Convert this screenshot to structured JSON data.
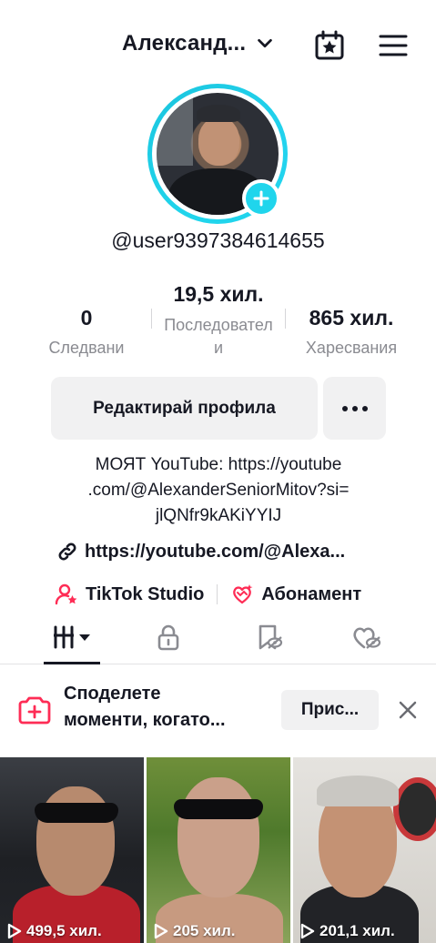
{
  "header": {
    "title": "Александ...",
    "icons": [
      "chevron-down-icon",
      "calendar-star-icon",
      "hamburger-menu-icon"
    ]
  },
  "profile": {
    "username": "@user9397384614655",
    "avatar_badge": "plus"
  },
  "stats": {
    "following": {
      "value": "0",
      "label": "Следвани"
    },
    "followers": {
      "value": "19,5 хил.",
      "label_line1": "Последовател",
      "label_line2": "и"
    },
    "likes": {
      "value": "865 хил.",
      "label": "Харесвания"
    }
  },
  "actions": {
    "edit_label": "Редактирай профила",
    "more_icon": "more-dots-icon"
  },
  "bio": {
    "line1": "МОЯТ YouTube: https://youtube",
    "line2": ".com/@AlexanderSeniorMitov?si=",
    "line3": "jlQNfr9kAKiYYIJ"
  },
  "link": {
    "text": "https://youtube.com/@Alexa..."
  },
  "studio": {
    "tiktok_studio": "TikTok Studio",
    "subscription": "Абонамент"
  },
  "tabs": [
    "videos-grid-icon",
    "lock-icon",
    "reposts-icon",
    "liked-icon"
  ],
  "banner": {
    "text_line1": "Споделете",
    "text_line2": "моменти, когато...",
    "button": "Прис...",
    "close_icon": "close-icon"
  },
  "videos": [
    {
      "views": "499,5 хил."
    },
    {
      "views": "205 хил."
    },
    {
      "views": "201,1 хил."
    }
  ],
  "colors": {
    "accent_cyan": "#20d5ec",
    "brand_red": "#fe2c55",
    "text": "#161823",
    "muted": "#8a8b91",
    "button_bg": "#f1f1f2"
  }
}
